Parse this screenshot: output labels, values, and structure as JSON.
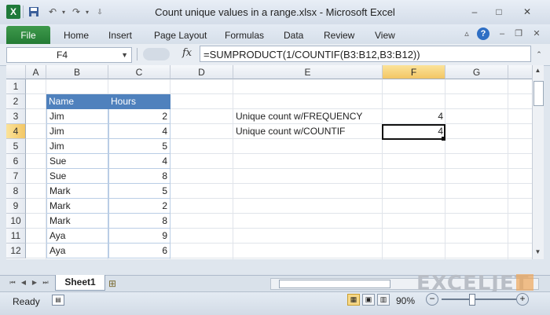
{
  "window": {
    "title": "Count unique values in a range.xlsx  -  Microsoft Excel",
    "app_icon": "excel-icon",
    "quick_access": [
      "save-icon",
      "undo-icon",
      "redo-icon",
      "customize-icon"
    ],
    "controls": {
      "minimize": "–",
      "maximize": "□",
      "close": "✕"
    }
  },
  "ribbon": {
    "file_label": "File",
    "tabs": [
      "Home",
      "Insert",
      "Page Layout",
      "Formulas",
      "Data",
      "Review",
      "View"
    ]
  },
  "formula_bar": {
    "name_box": "F4",
    "fx_label": "fx",
    "formula": "=SUMPRODUCT(1/COUNTIF(B3:B12,B3:B12))"
  },
  "grid": {
    "columns": [
      "A",
      "B",
      "C",
      "D",
      "E",
      "F",
      "G"
    ],
    "rows": [
      "1",
      "2",
      "3",
      "4",
      "5",
      "6",
      "7",
      "8",
      "9",
      "10",
      "11",
      "12"
    ],
    "selected_column": "F",
    "selected_row": "4",
    "table": {
      "headers": [
        "Name",
        "Hours"
      ],
      "rows": [
        [
          "Jim",
          "2"
        ],
        [
          "Jim",
          "4"
        ],
        [
          "Jim",
          "5"
        ],
        [
          "Sue",
          "4"
        ],
        [
          "Sue",
          "8"
        ],
        [
          "Mark",
          "5"
        ],
        [
          "Mark",
          "2"
        ],
        [
          "Mark",
          "8"
        ],
        [
          "Aya",
          "9"
        ],
        [
          "Aya",
          "6"
        ]
      ]
    },
    "results": [
      {
        "label": "Unique count w/FREQUENCY",
        "value": "4"
      },
      {
        "label": "Unique count w/COUNTIF",
        "value": "4"
      }
    ]
  },
  "sheets": {
    "tabs": [
      "Sheet1"
    ]
  },
  "status": {
    "ready": "Ready",
    "zoom": "90%"
  },
  "watermark": "EXCELJET",
  "colors": {
    "file_tab": "#2e8b3e",
    "table_header": "#4f81bd",
    "selected_header": "#f7d887"
  }
}
